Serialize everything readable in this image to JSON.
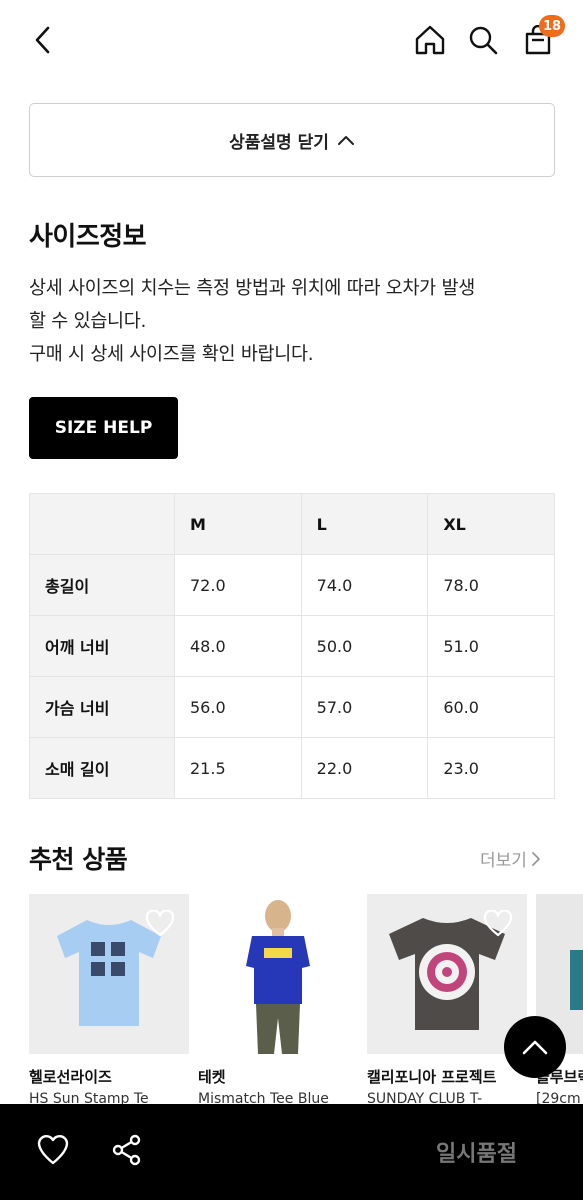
{
  "header": {
    "cart_count": "18"
  },
  "toggle": {
    "label": "상품설명 닫기"
  },
  "size_info": {
    "title": "사이즈정보",
    "desc_lines": [
      "상세 사이즈의 치수는 측정 방법과 위치에 따라 오차가 발생",
      "할 수 있습니다.",
      "구매 시 상세 사이즈를 확인 바랍니다."
    ],
    "help_button": "SIZE HELP"
  },
  "size_table": {
    "columns": [
      "M",
      "L",
      "XL"
    ],
    "rows": [
      {
        "label": "총길이",
        "values": [
          "72.0",
          "74.0",
          "78.0"
        ]
      },
      {
        "label": "어깨 너비",
        "values": [
          "48.0",
          "50.0",
          "51.0"
        ]
      },
      {
        "label": "가슴 너비",
        "values": [
          "56.0",
          "57.0",
          "60.0"
        ]
      },
      {
        "label": "소매 길이",
        "values": [
          "21.5",
          "22.0",
          "23.0"
        ]
      }
    ]
  },
  "recommend": {
    "title": "추천 상품",
    "more": "더보기",
    "items": [
      {
        "brand": "헬로선라이즈",
        "name": "HS Sun Stamp Te"
      },
      {
        "brand": "테켓",
        "name": "Mismatch Tee Blue"
      },
      {
        "brand": "캘리포니아 프로젝트",
        "name": "SUNDAY CLUB T-"
      },
      {
        "brand": "블루브릭",
        "name": "[29cm"
      }
    ]
  },
  "bottom": {
    "status": "일시품절"
  },
  "colors": {
    "badge": "#f26b1d",
    "bar": "#000000"
  }
}
